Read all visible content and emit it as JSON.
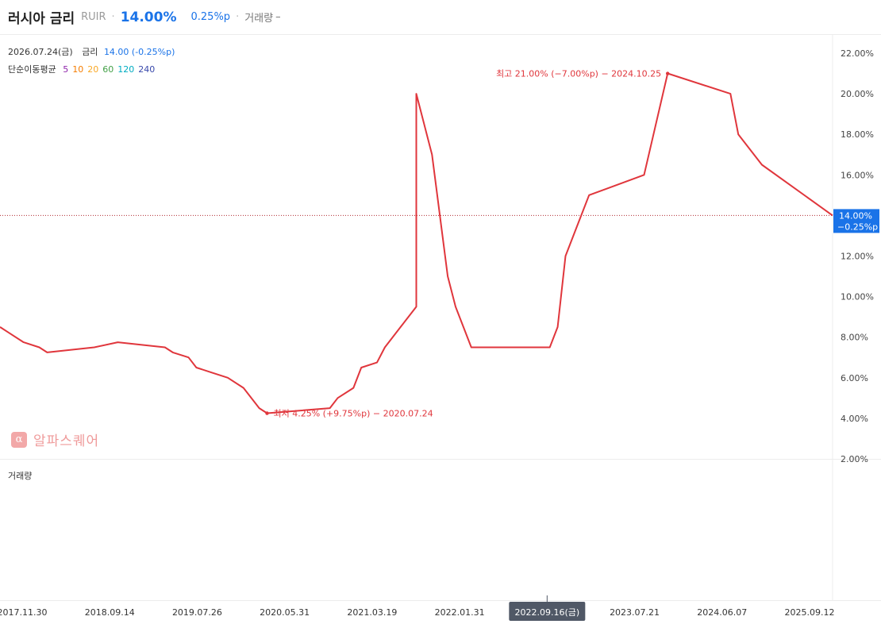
{
  "header": {
    "name": "러시아 금리",
    "code": "RUIR",
    "separator": "·",
    "price": "14.00%",
    "change": "0.25%p",
    "volume_label": "거래량",
    "volume_value": "–"
  },
  "info": {
    "date": "2026.07.24(금)",
    "rate_label": "금리",
    "rate_value": "14.00 (-0.25%p)",
    "ma_label": "단순이동평균",
    "ma_periods": [
      "5",
      "10",
      "20",
      "60",
      "120",
      "240"
    ]
  },
  "colors": {
    "line": "#e0363c",
    "accent": "#1a73e8",
    "ma": [
      "#8e24aa",
      "#f57c00",
      "#f9a825",
      "#43a047",
      "#00acc1",
      "#3949ab"
    ]
  },
  "watermark": {
    "icon": "alpha-icon",
    "symbol": "α",
    "text": "알파스퀘어"
  },
  "volume_panel_label": "거래량",
  "chart_data": {
    "type": "line",
    "y_ticks": [
      "2.00%",
      "4.00%",
      "6.00%",
      "8.00%",
      "10.00%",
      "12.00%",
      "14.00%",
      "16.00%",
      "18.00%",
      "20.00%",
      "22.00%"
    ],
    "ylim": [
      2,
      22.9
    ],
    "x_ticks": [
      "2017.11.30",
      "2018.09.14",
      "2019.07.26",
      "2020.05.31",
      "2021.03.19",
      "2022.01.31",
      "2022.09.16(금)",
      "2023.07.21",
      "2024.06.07",
      "2025.09.12"
    ],
    "x_range": [
      "2017.09",
      "2026.07"
    ],
    "series": [
      {
        "x": [
          "2017.09",
          "2017.10",
          "2017.12",
          "2018.02",
          "2018.03",
          "2018.09",
          "2018.12",
          "2019.06",
          "2019.07",
          "2019.09",
          "2019.10",
          "2019.12",
          "2020.02",
          "2020.04",
          "2020.06",
          "2020.07",
          "2021.03",
          "2021.04",
          "2021.06",
          "2021.07",
          "2021.09",
          "2021.10",
          "2021.12",
          "2022.02",
          "2022.02",
          "2022.04",
          "2022.05",
          "2022.06",
          "2022.07",
          "2022.09",
          "2023.07",
          "2023.08",
          "2023.09",
          "2023.10",
          "2023.12",
          "2024.07",
          "2024.10",
          "2025.06",
          "2025.07",
          "2025.09",
          "2025.10",
          "2026.07"
        ],
        "y": [
          8.5,
          8.25,
          7.75,
          7.5,
          7.25,
          7.5,
          7.75,
          7.5,
          7.25,
          7.0,
          6.5,
          6.25,
          6.0,
          5.5,
          4.5,
          4.25,
          4.5,
          5.0,
          5.5,
          6.5,
          6.75,
          7.5,
          8.5,
          9.5,
          20.0,
          17.0,
          14.0,
          11.0,
          9.5,
          7.5,
          7.5,
          8.5,
          12.0,
          13.0,
          15.0,
          16.0,
          21.0,
          20.0,
          18.0,
          17.0,
          16.5,
          14.0
        ]
      }
    ],
    "annotations": {
      "high": "최고 21.00% (−7.00%p) − 2024.10.25",
      "low": "최저 4.25% (+9.75%p) − 2020.07.24"
    },
    "last_value_tag": [
      "14.00%",
      "−0.25%p"
    ],
    "last_value": 14.0,
    "high_point": {
      "x": "2024.10",
      "y": 21.0
    },
    "low_point": {
      "x": "2020.07",
      "y": 4.25
    },
    "selected_x_label": "2022.09.16(금)"
  }
}
